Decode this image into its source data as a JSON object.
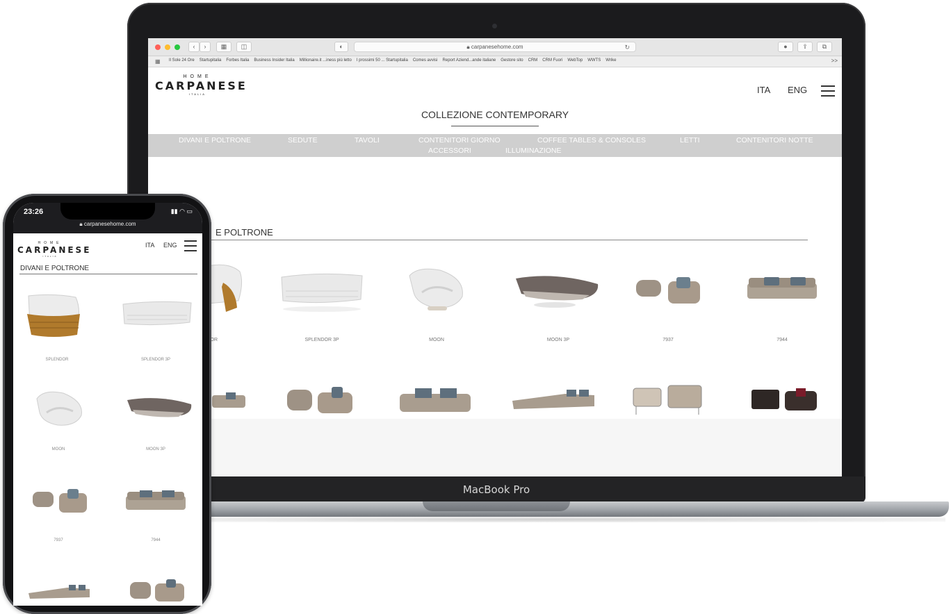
{
  "laptop": {
    "brand": "MacBook Pro",
    "browser": {
      "url": "carpanesehome.com",
      "bookmarks": [
        "Il Sole 24 Ore",
        "Startupitalia",
        "Forbes Italia",
        "Business Insider Italia",
        "Millionaire.it ...iness più letto",
        "I prossimi 50 ... Startupitalia",
        "Comes avvisi",
        "Report Aziend...ande italiane",
        "Gestore sito",
        "CRM",
        "CRM Fuori",
        "WebTop",
        "WWTS",
        "Wrike"
      ],
      "more": ">>"
    },
    "site": {
      "logo": {
        "home": "HOME",
        "name": "CARPANESE",
        "country": "ITALIA"
      },
      "lang_ita": "ITA",
      "lang_eng": "ENG",
      "collection_title": "COLLEZIONE CONTEMPORARY",
      "categories": [
        "DIVANI E POLTRONE",
        "SEDUTE",
        "TAVOLI",
        "CONTENITORI GIORNO",
        "COFFEE TABLES & CONSOLES",
        "LETTI",
        "CONTENITORI NOTTE",
        "ACCESSORI",
        "ILLUMINAZIONE"
      ],
      "section_title": "E POLTRONE",
      "products_row1": [
        "OR",
        "SPLENDOR 3P",
        "MOON",
        "MOON 3P",
        "7937",
        "7944"
      ]
    }
  },
  "phone": {
    "time": "23:26",
    "url": "carpanesehome.com",
    "logo": {
      "home": "HOME",
      "name": "CARPANESE",
      "country": "ITALIA"
    },
    "lang_ita": "ITA",
    "lang_eng": "ENG",
    "section_title": "DIVANI E POLTRONE",
    "products": [
      "SPLENDOR",
      "SPLENDOR 3P",
      "MOON",
      "MOON 3P",
      "7937",
      "7944"
    ]
  }
}
